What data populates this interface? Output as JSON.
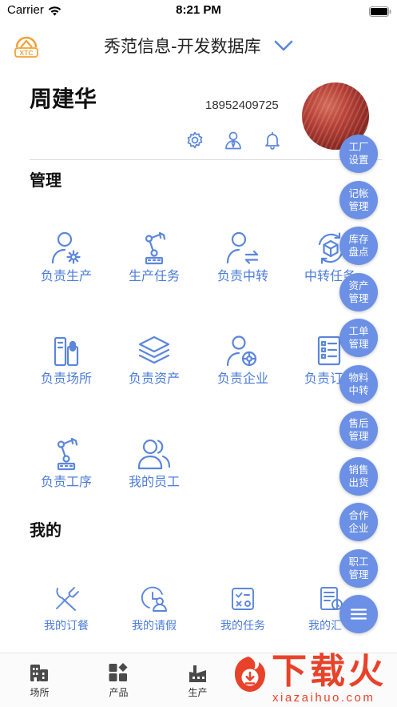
{
  "status_bar": {
    "carrier": "Carrier",
    "time": "8:21 PM"
  },
  "header": {
    "logo_text": "XTC",
    "title": "秀范信息-开发数据库",
    "dropdown_icon": "chevron-down-icon"
  },
  "profile": {
    "name": "周建华",
    "phone": "18952409725",
    "actions": [
      {
        "icon": "gear-icon"
      },
      {
        "icon": "manager-icon"
      },
      {
        "icon": "bell-icon"
      }
    ]
  },
  "management": {
    "title": "管理",
    "items": [
      {
        "label": "负责生产",
        "icon": "person-gear-icon"
      },
      {
        "label": "生产任务",
        "icon": "robot-arm-icon"
      },
      {
        "label": "负责中转",
        "icon": "person-transfer-icon"
      },
      {
        "label": "中转任务",
        "icon": "cube-cycle-icon"
      },
      {
        "label": "负责场所",
        "icon": "site-icon"
      },
      {
        "label": "负责资产",
        "icon": "layers-icon"
      },
      {
        "label": "负责企业",
        "icon": "person-target-icon"
      },
      {
        "label": "负责订",
        "icon": "document-list-icon"
      },
      {
        "label": "负责工序",
        "icon": "robot-arm-icon"
      },
      {
        "label": "我的员工",
        "icon": "two-people-icon"
      }
    ]
  },
  "mine": {
    "title": "我的",
    "items": [
      {
        "label": "我的订餐",
        "icon": "fork-knife-icon"
      },
      {
        "label": "我的请假",
        "icon": "clock-person-icon"
      },
      {
        "label": "我的任务",
        "icon": "checklist-icon"
      },
      {
        "label": "我的汇",
        "icon": "report-icon"
      }
    ]
  },
  "floating_menu": {
    "items": [
      {
        "lines": [
          "工厂",
          "设置"
        ]
      },
      {
        "lines": [
          "记帐",
          "管理"
        ]
      },
      {
        "lines": [
          "库存",
          "盘点"
        ]
      },
      {
        "lines": [
          "资产",
          "管理"
        ]
      },
      {
        "lines": [
          "工单",
          "管理"
        ]
      },
      {
        "lines": [
          "物料",
          "中转"
        ]
      },
      {
        "lines": [
          "售后",
          "管理"
        ]
      },
      {
        "lines": [
          "销售",
          "出货"
        ]
      },
      {
        "lines": [
          "合作",
          "企业"
        ]
      },
      {
        "lines": [
          "职工",
          "管理"
        ]
      }
    ],
    "toggle_icon": "menu-icon"
  },
  "tab_bar": {
    "items": [
      {
        "label": "场所",
        "icon": "building-icon"
      },
      {
        "label": "产品",
        "icon": "grid-icon"
      },
      {
        "label": "生产",
        "icon": "factory-icon"
      }
    ]
  },
  "watermark": {
    "brand": "下载火",
    "domain": "xiazaihuo.com"
  },
  "colors": {
    "accent": "#5b86dc",
    "label": "#4c7cd8",
    "fab": "#6b90e5",
    "logo": "#f2a03a",
    "watermark": "#e8422a"
  }
}
